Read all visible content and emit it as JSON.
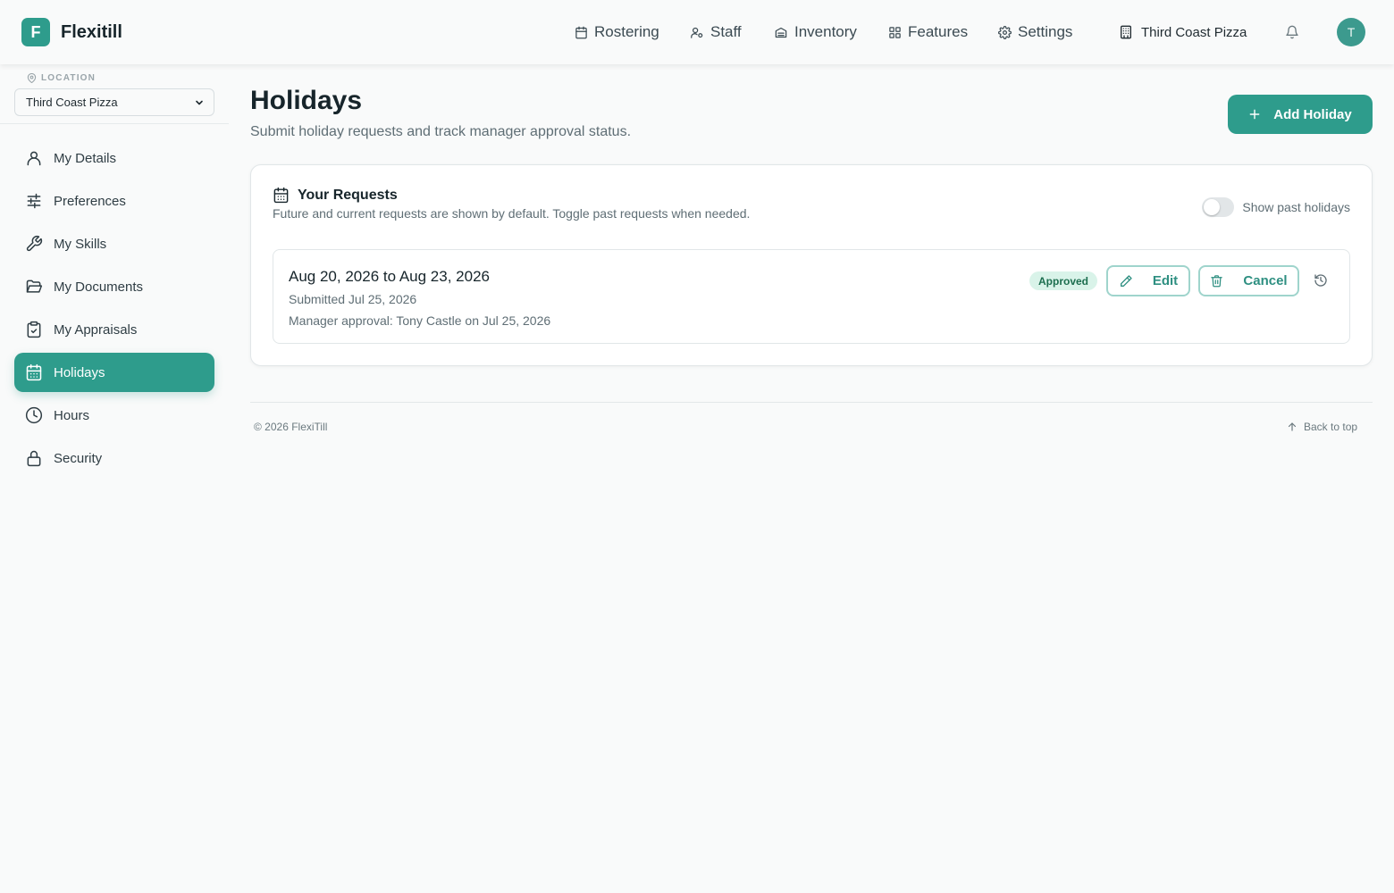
{
  "brand": {
    "letter": "F",
    "name": "Flexitill",
    "accent": "#2e9c8c"
  },
  "nav": {
    "items": [
      {
        "label": "Rostering",
        "icon": "calendar-icon"
      },
      {
        "label": "Staff",
        "icon": "staff-icon"
      },
      {
        "label": "Inventory",
        "icon": "inventory-icon"
      },
      {
        "label": "Features",
        "icon": "grid-icon"
      },
      {
        "label": "Settings",
        "icon": "gear-icon"
      }
    ],
    "location": "Third Coast Pizza",
    "avatar": "T"
  },
  "sidebar": {
    "location_label": "LOCATION",
    "location_value": "Third Coast Pizza",
    "items": [
      {
        "label": "My Details",
        "icon": "user-icon"
      },
      {
        "label": "Preferences",
        "icon": "sliders-icon"
      },
      {
        "label": "My Skills",
        "icon": "wrench-icon"
      },
      {
        "label": "My Documents",
        "icon": "folder-icon"
      },
      {
        "label": "My Appraisals",
        "icon": "clipboard-check-icon"
      },
      {
        "label": "Holidays",
        "icon": "calendar-grid-icon",
        "active": true
      },
      {
        "label": "Hours",
        "icon": "clock-icon"
      },
      {
        "label": "Security",
        "icon": "lock-icon"
      }
    ]
  },
  "page": {
    "title": "Holidays",
    "subtitle": "Submit holiday requests and track manager approval status.",
    "add_label": "Add Holiday"
  },
  "requests": {
    "title": "Your Requests",
    "subtitle": "Future and current requests are shown by default. Toggle past requests when needed.",
    "toggle_label": "Show past holidays",
    "toggle_on": false,
    "items": [
      {
        "dates": "Aug 20, 2026 to Aug 23, 2026",
        "submitted": "Submitted Jul 25, 2026",
        "approval": "Manager approval: Tony Castle on Jul 25, 2026",
        "status": "Approved",
        "edit_label": "Edit",
        "cancel_label": "Cancel"
      }
    ]
  },
  "footer": {
    "copyright": "© 2026 FlexiTill",
    "back_to_top": "Back to top"
  }
}
